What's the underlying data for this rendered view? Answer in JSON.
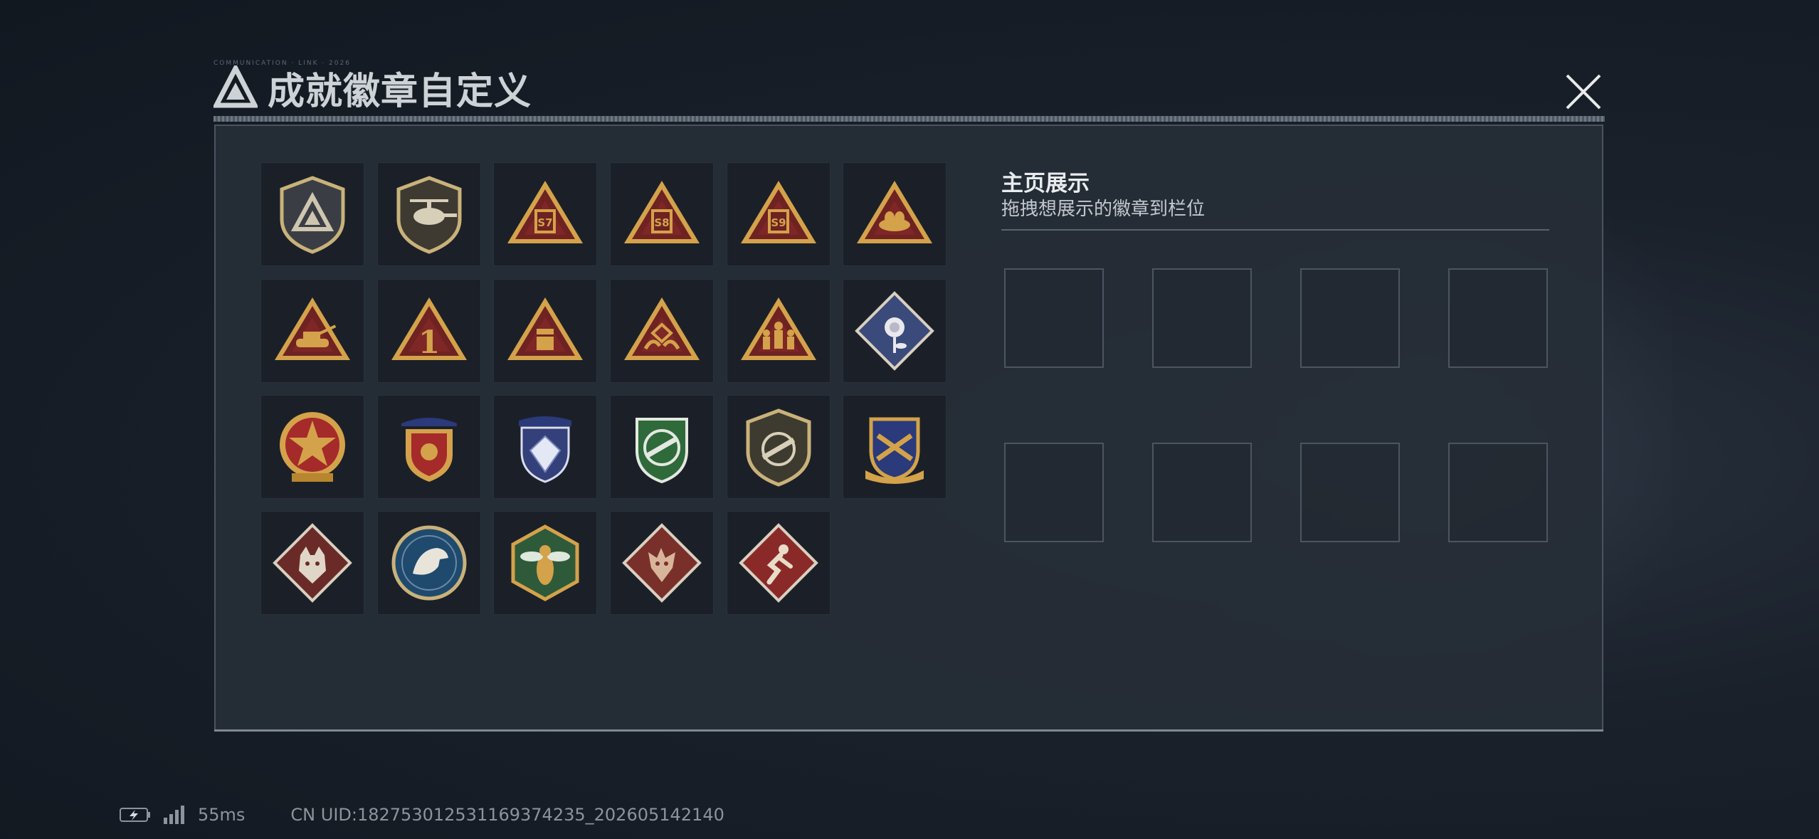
{
  "header": {
    "title": "成就徽章自定义",
    "tiny_text": "COMMUNICATION · LINK · 2026"
  },
  "showcase": {
    "title": "主页展示",
    "subtitle": "拖拽想展示的徽章到栏位"
  },
  "badges": [
    {
      "icon": "delta-shield-icon"
    },
    {
      "icon": "helicopter-shield-icon"
    },
    {
      "icon": "s7-season-badge-icon",
      "label": "S7"
    },
    {
      "icon": "s8-season-badge-icon",
      "label": "S8"
    },
    {
      "icon": "s9-season-badge-icon",
      "label": "S9"
    },
    {
      "icon": "nest-eggs-badge-icon"
    },
    {
      "icon": "tank-badge-icon"
    },
    {
      "icon": "number-one-badge-icon",
      "label": "1"
    },
    {
      "icon": "crate-badge-icon"
    },
    {
      "icon": "hands-badge-icon"
    },
    {
      "icon": "soldiers-badge-icon"
    },
    {
      "icon": "rose-diamond-badge-icon"
    },
    {
      "icon": "star-medal-icon"
    },
    {
      "icon": "wings-crest-icon"
    },
    {
      "icon": "diamond-crest-icon"
    },
    {
      "icon": "green-rifle-crest-icon"
    },
    {
      "icon": "rifle-shield-icon"
    },
    {
      "icon": "crossed-rifles-crest-icon"
    },
    {
      "icon": "wolf-diamond-icon"
    },
    {
      "icon": "eagle-round-icon"
    },
    {
      "icon": "wasp-hexagon-icon"
    },
    {
      "icon": "dragon-diamond-icon"
    },
    {
      "icon": "runner-diamond-icon"
    }
  ],
  "slots_count": 8,
  "status": {
    "ping": "55ms",
    "uid": "CN UID:18275301253116937423​5_202605142140"
  },
  "colors": {
    "gold": "#d4a24a",
    "dark_red": "#6e2222",
    "panel": "#262d37",
    "slot_border": "#4b5561"
  }
}
